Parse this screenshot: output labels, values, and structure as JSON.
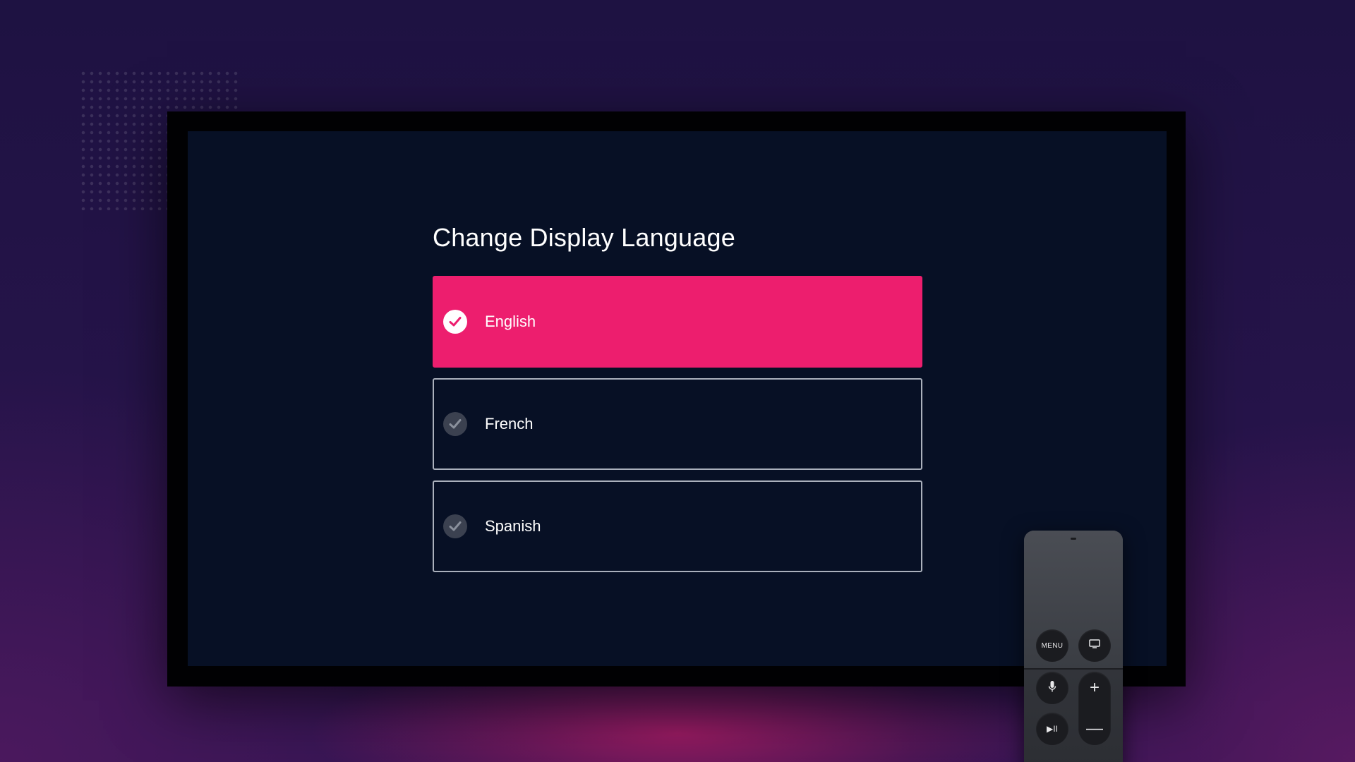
{
  "screen": {
    "title": "Change Display Language"
  },
  "languages": [
    {
      "label": "English",
      "selected": true
    },
    {
      "label": "French",
      "selected": false
    },
    {
      "label": "Spanish",
      "selected": false
    }
  ],
  "remote": {
    "menu_label": "MENU",
    "play_pause_label": "▶II",
    "volume_up_label": "+",
    "volume_down_label": "—",
    "icons": [
      "tv-icon",
      "microphone-icon"
    ]
  },
  "colors": {
    "accent": "#ed1e6e",
    "screen_background": "#071025",
    "option_border": "#aab0bc",
    "unselected_check": "#3b4150"
  }
}
